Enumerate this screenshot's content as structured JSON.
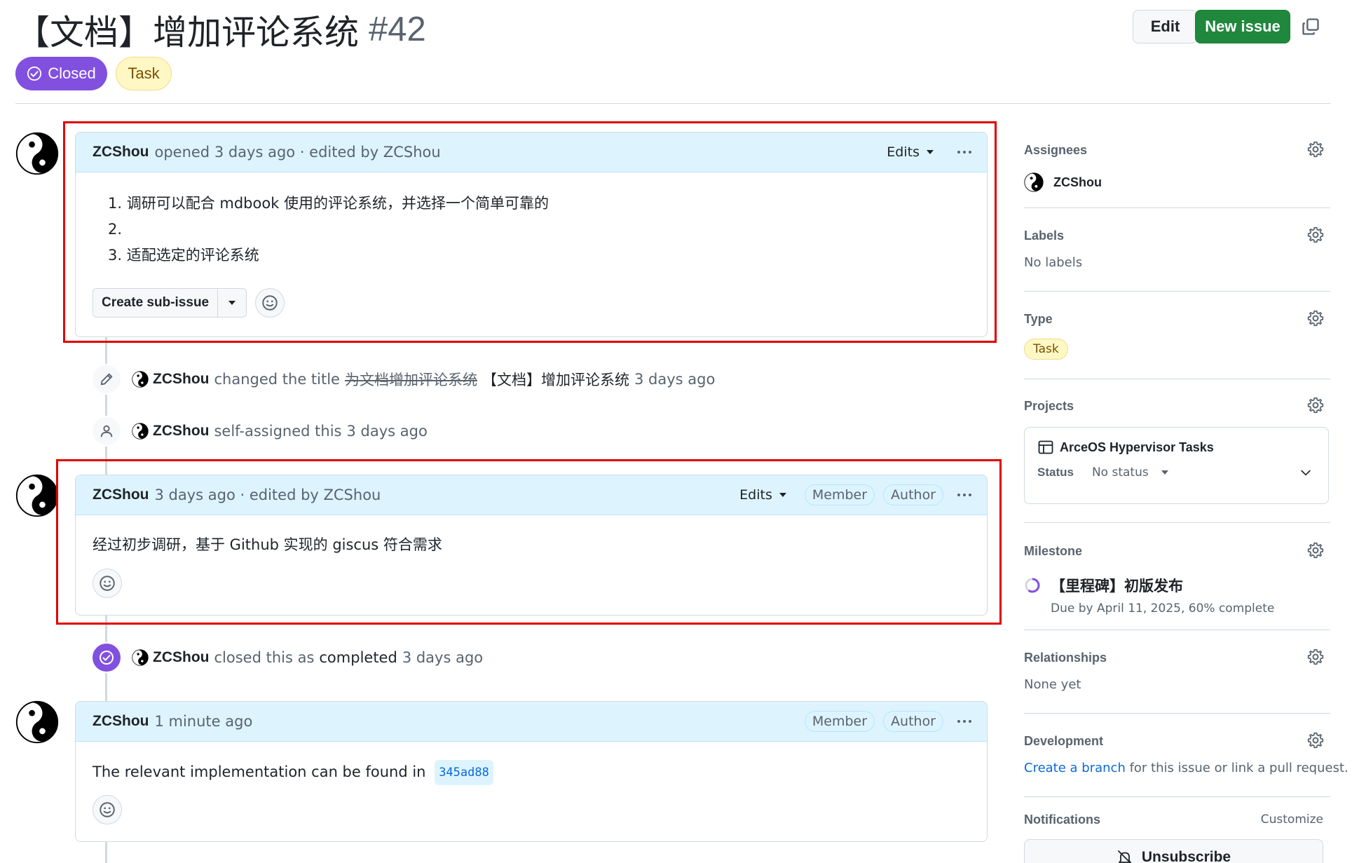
{
  "issue": {
    "title": "【文档】增加评论系统",
    "number": "#42",
    "state": "Closed",
    "type": "Task"
  },
  "header": {
    "edit_label": "Edit",
    "new_issue_label": "New issue"
  },
  "colors": {
    "closed": "#8250df",
    "primary": "#1f883d",
    "link": "#0969da",
    "highlight_box": "#e00000"
  },
  "comments": [
    {
      "author": "ZCShou",
      "meta": "opened 3 days ago · edited by ZCShou",
      "edits_label": "Edits",
      "items": [
        "1. 调研可以配合 mdbook 使用的评论系统，并选择一个简单可靠的",
        "2.",
        "3. 适配选定的评论系统"
      ],
      "sub_issue_label": "Create sub-issue"
    },
    {
      "author": "ZCShou",
      "meta": "3 days ago · edited by ZCShou",
      "edits_label": "Edits",
      "roles": [
        "Member",
        "Author"
      ],
      "body": "经过初步调研，基于 Github 实现的 giscus 符合需求"
    },
    {
      "author": "ZCShou",
      "meta": "1 minute ago",
      "roles": [
        "Member",
        "Author"
      ],
      "body": "The relevant implementation can be found in",
      "commit": "345ad88"
    }
  ],
  "events": {
    "rename": {
      "author": "ZCShou",
      "action": "changed the title",
      "old_title": "为文档增加评论系统",
      "new_title": "【文档】增加评论系统",
      "time": "3 days ago"
    },
    "assign": {
      "author": "ZCShou",
      "action": "self-assigned this",
      "time": "3 days ago"
    },
    "close": {
      "author": "ZCShou",
      "action": "closed this as",
      "reason": "completed",
      "time": "3 days ago"
    }
  },
  "sidebar": {
    "assignees": {
      "title": "Assignees",
      "value": "ZCShou"
    },
    "labels": {
      "title": "Labels",
      "value": "No labels"
    },
    "type": {
      "title": "Type",
      "value": "Task"
    },
    "projects": {
      "title": "Projects",
      "project_name": "ArceOS Hypervisor Tasks",
      "status_label": "Status",
      "status_value": "No status"
    },
    "milestone": {
      "title": "Milestone",
      "name": "【里程碑】初版发布",
      "due": "Due by April 11, 2025, 60% complete",
      "progress": 0.6
    },
    "relationships": {
      "title": "Relationships",
      "value": "None yet"
    },
    "development": {
      "title": "Development",
      "link_text": "Create a branch",
      "rest_text": " for this issue or link a pull request."
    },
    "notifications": {
      "title": "Notifications",
      "customize": "Customize",
      "button": "Unsubscribe"
    }
  }
}
